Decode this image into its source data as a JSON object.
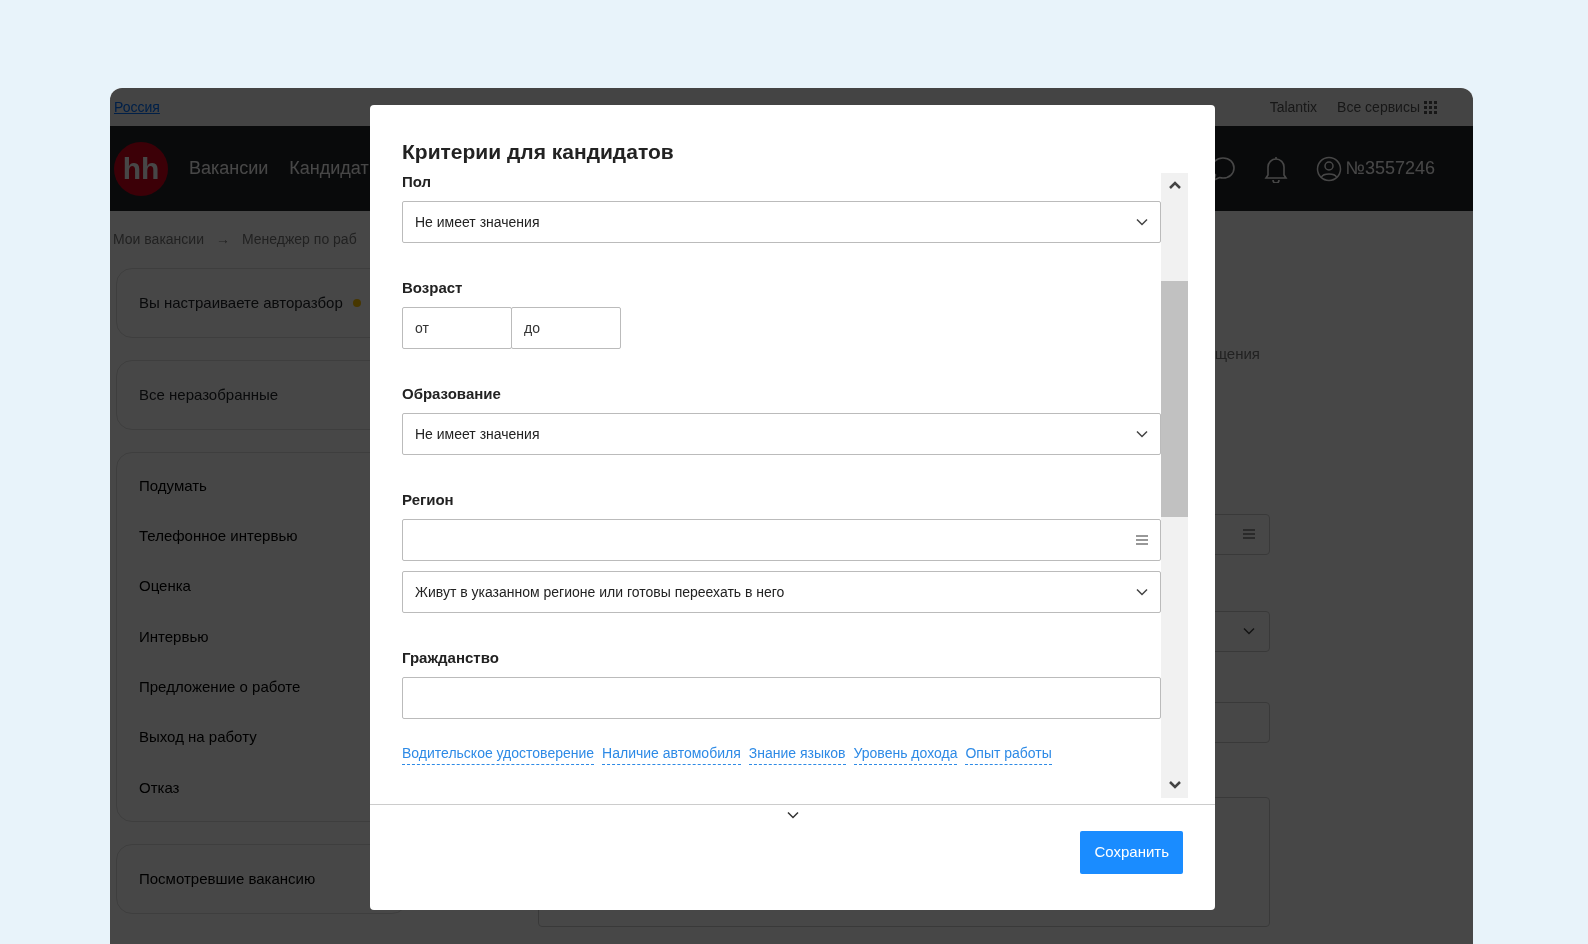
{
  "top_bar": {
    "region": "Россия",
    "links": [
      "Talantix",
      "Все сервисы"
    ]
  },
  "header": {
    "logo": "hh",
    "nav": [
      "Вакансии",
      "Кандидат"
    ],
    "account": "№3557246"
  },
  "breadcrumbs": [
    "Мои вакансии",
    "→",
    "Менеджер по раб"
  ],
  "sidebar": {
    "autosort": "Вы настраиваете авторазбор",
    "unsorted": "Все неразобранные",
    "stages": [
      "Подумать",
      "Телефонное интервью",
      "Оценка",
      "Интервью",
      "Предложение о работе",
      "Выход на работу",
      "Отказ"
    ],
    "viewed": "Посмотревшие вакансию"
  },
  "content_fragment": "щения",
  "modal": {
    "title": "Критерии для кандидатов",
    "fields": [
      {
        "kind": "select",
        "label": "Пол",
        "value": "Не имеет значения"
      },
      {
        "kind": "range",
        "label": "Возраст",
        "from_placeholder": "от",
        "to_placeholder": "до"
      },
      {
        "kind": "select",
        "label": "Образование",
        "value": "Не имеет значения"
      },
      {
        "kind": "region",
        "label": "Регион",
        "value": "Живут в указанном регионе или готовы переехать в него"
      },
      {
        "kind": "text",
        "label": "Гражданство"
      }
    ],
    "more_links": [
      "Водительское удостоверение",
      "Наличие автомобиля",
      "Знание языков",
      "Уровень дохода",
      "Опыт работы"
    ],
    "save_button": "Сохранить"
  }
}
